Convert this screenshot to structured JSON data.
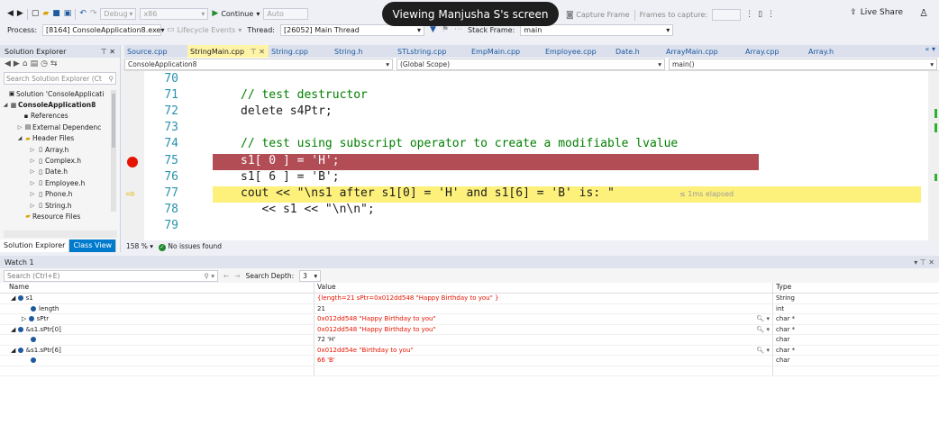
{
  "overlay": {
    "screen_share": "Viewing Manjusha S's screen"
  },
  "toolbar": {
    "config": "Debug",
    "platform": "x86",
    "continue": "Continue",
    "attach": "Auto",
    "capture_frame": "Capture Frame",
    "frames_to_capture": "Frames to capture:",
    "live_share": "Live Share"
  },
  "debugbar": {
    "process_label": "Process:",
    "process_value": "[8164] ConsoleApplication8.exe",
    "lifecycle": "Lifecycle Events",
    "thread_label": "Thread:",
    "thread_value": "[26052] Main Thread",
    "stack_label": "Stack Frame:",
    "stack_value": "main"
  },
  "solution_explorer": {
    "title": "Solution Explorer",
    "search_placeholder": "Search Solution Explorer (Ct",
    "tree": [
      {
        "label": "Solution 'ConsoleApplicati",
        "icon": "solution-icon"
      },
      {
        "label": "ConsoleApplication8",
        "icon": "project-icon"
      },
      {
        "label": "References",
        "icon": "references-icon"
      },
      {
        "label": "External Dependenc",
        "icon": "external-deps-icon"
      },
      {
        "label": "Header Files",
        "icon": "folder-icon"
      },
      {
        "label": "Array.h",
        "icon": "header-file-icon"
      },
      {
        "label": "Complex.h",
        "icon": "header-file-icon"
      },
      {
        "label": "Date.h",
        "icon": "header-file-icon"
      },
      {
        "label": "Employee.h",
        "icon": "header-file-icon"
      },
      {
        "label": "Phone.h",
        "icon": "header-file-icon"
      },
      {
        "label": "String.h",
        "icon": "header-file-icon"
      },
      {
        "label": "Resource Files",
        "icon": "folder-icon"
      }
    ],
    "tab_solution": "Solution Explorer",
    "tab_class": "Class View"
  },
  "editor": {
    "tabs": [
      "Source.cpp",
      "StringMain.cpp",
      "String.cpp",
      "String.h",
      "STLstring.cpp",
      "EmpMain.cpp",
      "Employee.cpp",
      "Date.h",
      "ArrayMain.cpp",
      "Array.cpp",
      "Array.h"
    ],
    "active_tab": "StringMain.cpp",
    "project_scope": "ConsoleApplication8",
    "global_scope": "(Global Scope)",
    "function_scope": "main()",
    "lines": [
      {
        "num": "70",
        "code": ""
      },
      {
        "num": "71",
        "code": "// test destructor"
      },
      {
        "num": "72",
        "code": "delete s4Ptr;"
      },
      {
        "num": "73",
        "code": ""
      },
      {
        "num": "74",
        "code": "// test using subscript operator to create a modifiable lvalue"
      },
      {
        "num": "75",
        "code": "s1[ 0 ] = 'H';"
      },
      {
        "num": "76",
        "code": "s1[ 6 ] = 'B';"
      },
      {
        "num": "77",
        "code": "cout << \"\\ns1 after s1[0] = 'H' and s1[6] = 'B' is: \""
      },
      {
        "num": "78",
        "code": "   << s1 << \"\\n\\n\";"
      },
      {
        "num": "79",
        "code": ""
      }
    ],
    "elapsed": "≤ 1ms elapsed",
    "zoom": "158 %",
    "issues": "No issues found"
  },
  "watch": {
    "title": "Watch 1",
    "search_placeholder": "Search (Ctrl+E)",
    "search_depth_label": "Search Depth:",
    "search_depth": "3",
    "col_name": "Name",
    "col_value": "Value",
    "col_type": "Type",
    "rows": [
      {
        "name": "s1",
        "value": "{length=21 sPtr=0x012dd548 \"Happy Birthday to you\" }",
        "type": "String"
      },
      {
        "name": "length",
        "value": "21",
        "type": "int"
      },
      {
        "name": "sPtr",
        "value": "0x012dd548 \"Happy Birthday to you\"",
        "type": "char *"
      },
      {
        "name": "&s1.sPtr[0]",
        "value": "0x012dd548 \"Happy Birthday to you\"",
        "type": "char *"
      },
      {
        "name": "",
        "value": "72 'H'",
        "type": "char"
      },
      {
        "name": "&s1.sPtr[6]",
        "value": "0x012dd54e \"Birthday to you\"",
        "type": "char *"
      },
      {
        "name": "",
        "value": "66 'B'",
        "type": "char"
      }
    ]
  }
}
